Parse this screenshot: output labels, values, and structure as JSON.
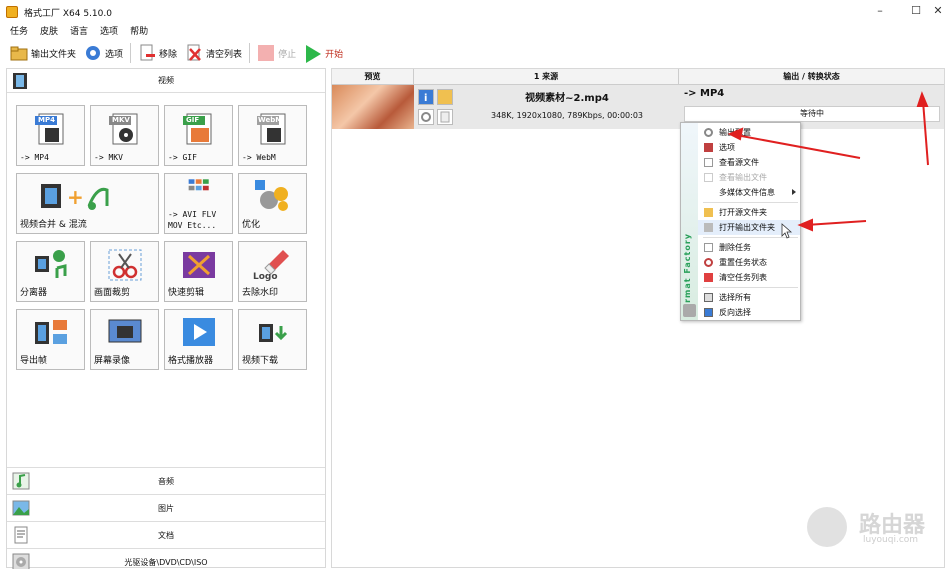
{
  "window": {
    "title": "格式工厂 X64 5.10.0",
    "controls": [
      "–",
      "☐",
      "✕"
    ]
  },
  "menu": [
    "任务",
    "皮肤",
    "语言",
    "选项",
    "帮助"
  ],
  "toolbar": {
    "output_folder": "输出文件夹",
    "options": "选项",
    "remove": "移除",
    "clear_list": "清空列表",
    "stop": "停止",
    "start": "开始"
  },
  "left": {
    "video_category": "视频",
    "tiles": [
      {
        "label": "-> MP4",
        "badge": "MP4"
      },
      {
        "label": "-> MKV",
        "badge": "MKV"
      },
      {
        "label": "-> GIF",
        "badge": "GIF"
      },
      {
        "label": "-> WebM",
        "badge": "WebM"
      },
      {
        "label": "视频合并 & 混流"
      },
      {
        "label": "-> AVI FLV",
        "label2": "MOV Etc..."
      },
      {
        "label": "优化"
      },
      {
        "label": "分离器"
      },
      {
        "label": "画面裁剪"
      },
      {
        "label": "快速剪辑"
      },
      {
        "label": "去除水印",
        "art_text": "Logo"
      },
      {
        "label": "导出帧"
      },
      {
        "label": "屏幕录像"
      },
      {
        "label": "格式播放器"
      },
      {
        "label": "视频下载"
      }
    ],
    "bottom_categories": [
      "音频",
      "图片",
      "文档",
      "光驱设备\\DVD\\CD\\ISO"
    ]
  },
  "task_list": {
    "columns": [
      "预览",
      "1 来源",
      "输出 / 转换状态"
    ],
    "row": {
      "filename": "视频素材~2.mp4",
      "info": "348K, 1920x1080, 789Kbps, 00:00:03",
      "output_format": "-> MP4",
      "status": "等待中"
    }
  },
  "context_menu": {
    "side_text": "Format Factory",
    "items": [
      {
        "label": "输出配置",
        "enabled": true
      },
      {
        "label": "选项",
        "enabled": true
      },
      {
        "label": "查看源文件",
        "enabled": true
      },
      {
        "label": "查看输出文件",
        "enabled": false
      },
      {
        "label": "多媒体文件信息",
        "enabled": true,
        "submenu": true
      },
      {
        "label": "打开源文件夹",
        "enabled": true
      },
      {
        "label": "打开输出文件夹",
        "enabled": true,
        "highlighted": true
      },
      {
        "label": "删除任务",
        "enabled": true
      },
      {
        "label": "重置任务状态",
        "enabled": true
      },
      {
        "label": "清空任务列表",
        "enabled": true
      },
      {
        "label": "选择所有",
        "enabled": true
      },
      {
        "label": "反向选择",
        "enabled": true
      }
    ]
  },
  "watermark": {
    "text": "路由器",
    "sub": "luyouqi.com"
  },
  "colors": {
    "arrow": "#e02020",
    "start_green": "#2db84a",
    "selection": "#e4eefb"
  }
}
